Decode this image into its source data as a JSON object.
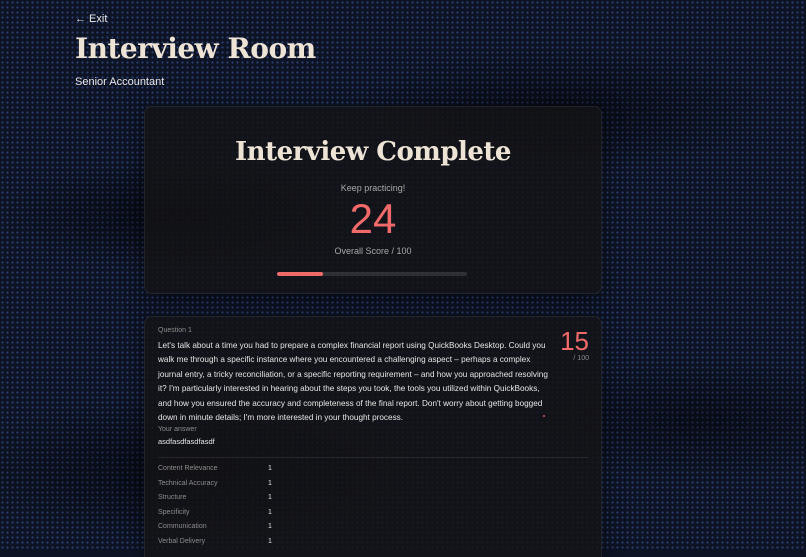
{
  "nav": {
    "back_label": "← Exit"
  },
  "header": {
    "title": "Interview Room",
    "role": "Senior Accountant"
  },
  "summary": {
    "heading": "Interview Complete",
    "message": "Keep practicing!",
    "score": "24",
    "score_label": "Overall Score / 100",
    "progress_percent": 24,
    "accent_color": "#f06a6a"
  },
  "question": {
    "label": "Question 1",
    "text": "Let's talk about a time you had to prepare a complex financial report using QuickBooks Desktop. Could you walk me through a specific instance where you encountered a challenging aspect – perhaps a complex journal entry, a tricky reconciliation, or a specific reporting requirement – and how you approached resolving it? I'm particularly interested in hearing about the steps you took, the tools you utilized within QuickBooks, and how you ensured the accuracy and completeness of the final report. Don't worry about getting bogged down in minute details; I'm more interested in your thought process.",
    "score": "15",
    "score_out_of": "/ 100",
    "answer_label": "Your answer",
    "answer": "asdfasdfasdfasdf",
    "metrics": [
      {
        "name": "Content Relevance",
        "value": "1"
      },
      {
        "name": "Technical Accuracy",
        "value": "1"
      },
      {
        "name": "Structure",
        "value": "1"
      },
      {
        "name": "Specificity",
        "value": "1"
      },
      {
        "name": "Communication",
        "value": "1"
      },
      {
        "name": "Verbal Delivery",
        "value": "1"
      }
    ]
  }
}
